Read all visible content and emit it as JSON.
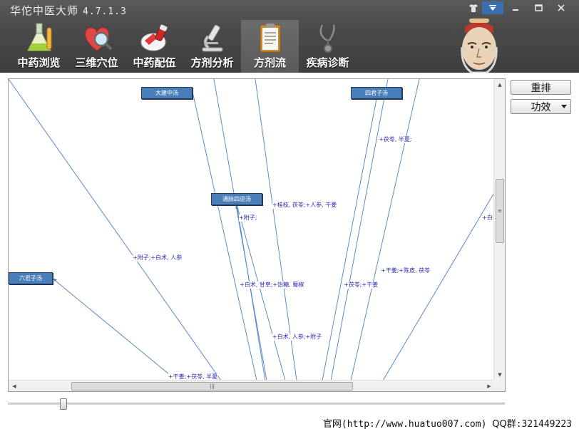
{
  "app": {
    "title": "华佗中医大师",
    "version": "4.7.1.3"
  },
  "window_controls": {
    "skin": "shirt-icon",
    "menu": "▼",
    "minimize": "—",
    "maximize": "☐",
    "close": "✕"
  },
  "tabs": [
    {
      "label": "中药浏览",
      "icon": "flask-icon"
    },
    {
      "label": "三维穴位",
      "icon": "heart-magnifier-icon"
    },
    {
      "label": "中药配伍",
      "icon": "pill-bottle-icon"
    },
    {
      "label": "方剂分析",
      "icon": "microscope-icon"
    },
    {
      "label": "方剂流",
      "icon": "clipboard-icon",
      "active": true
    },
    {
      "label": "疾病诊断",
      "icon": "stethoscope-icon"
    }
  ],
  "flow": {
    "nodes": [
      {
        "label": "大建中汤"
      },
      {
        "label": "四君子汤"
      },
      {
        "label": "通脉四逆汤"
      },
      {
        "label": "六君子汤"
      }
    ],
    "edge_labels": [
      "+茯苓, 半夏;",
      "+桂枝, 茯苓;+人参, 干姜",
      "+附子;",
      "+附子;+白术, 人参",
      "+白术, 甘草;+饴糖, 蜀椒",
      "+茯苓;+干姜",
      "+干姜;+陈皮, 茯苓",
      "+白术, 人参;+附子",
      "+干姜;+茯苓, 半夏",
      "+白"
    ]
  },
  "side_buttons": {
    "rearrange": "重排",
    "effect_dropdown": "功效"
  },
  "footer": {
    "prefix": "官网",
    "url": "(http://www.huatuo007.com)",
    "qq_label": "QQ群",
    "qq_value": ":321449223"
  },
  "colors": {
    "node_fill": "#4a7eb8",
    "edge": "#5a8ac8",
    "edge_label": "#2a2ab4",
    "titlebar": "#4a4a4a"
  }
}
